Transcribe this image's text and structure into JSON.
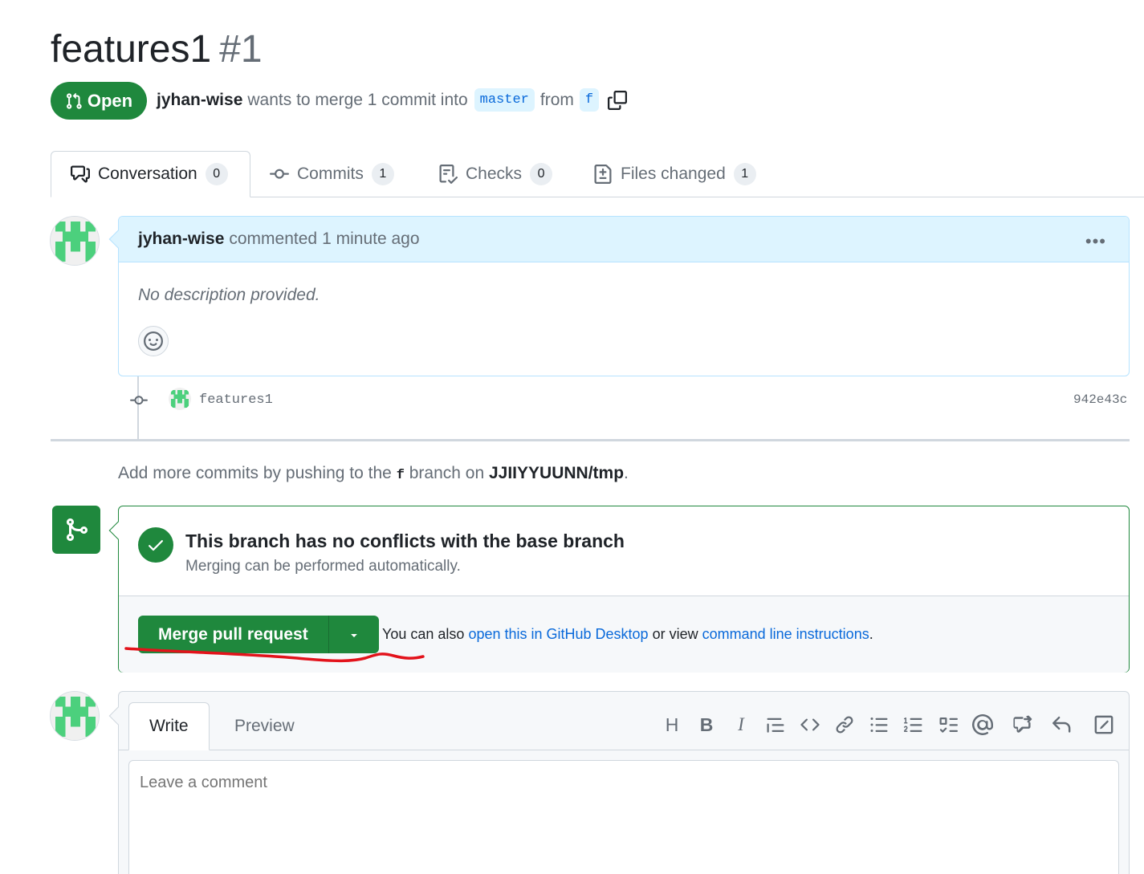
{
  "pr": {
    "title": "features1",
    "number": "#1",
    "state": "Open",
    "author": "jyhan-wise",
    "summary_text": "wants to merge 1 commit into",
    "base_branch": "master",
    "from_text": "from",
    "head_branch": "f"
  },
  "tabs": [
    {
      "label": "Conversation",
      "count": "0",
      "icon": "comment-discussion-icon"
    },
    {
      "label": "Commits",
      "count": "1",
      "icon": "git-commit-icon"
    },
    {
      "label": "Checks",
      "count": "0",
      "icon": "checklist-icon"
    },
    {
      "label": "Files changed",
      "count": "1",
      "icon": "file-diff-icon"
    }
  ],
  "comment": {
    "author": "jyhan-wise",
    "action": "commented",
    "time": "1 minute ago",
    "body": "No description provided."
  },
  "commit": {
    "message": "features1",
    "sha": "942e43c"
  },
  "hint": {
    "prefix": "Add more commits by pushing to the",
    "branch": "f",
    "middle": "branch on",
    "repo": "JJIIYYUUNN/tmp",
    "suffix": "."
  },
  "merge": {
    "title": "This branch has no conflicts with the base branch",
    "subtitle": "Merging can be performed automatically.",
    "button": "Merge pull request",
    "also_prefix": "You can also",
    "desktop_link": "open this in GitHub Desktop",
    "also_middle": "or view",
    "cli_link": "command line instructions",
    "also_suffix": "."
  },
  "form": {
    "write_tab": "Write",
    "preview_tab": "Preview",
    "heading_btn": "H",
    "bold_btn": "B",
    "italic_btn": "I",
    "placeholder": "Leave a comment"
  },
  "colors": {
    "green": "#1f883d",
    "link": "#0969da",
    "annotation": "#e3131b"
  }
}
